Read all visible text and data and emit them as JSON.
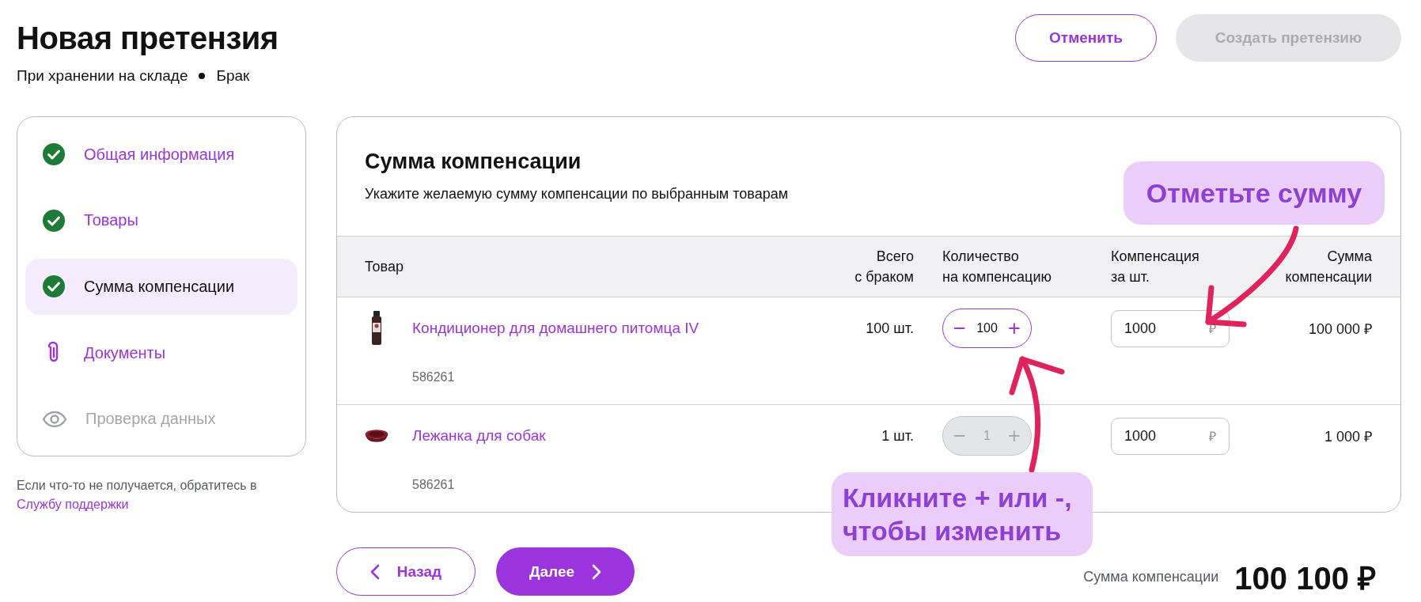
{
  "header": {
    "title": "Новая претензия",
    "subtitle": [
      "При хранении на складе",
      "Брак"
    ],
    "buttons": [
      {
        "kind": "outline",
        "label": "Отменить",
        "disabled": false
      },
      {
        "kind": "primary",
        "label": "Создать претензию",
        "disabled": true
      }
    ]
  },
  "steps": [
    {
      "kind": "check",
      "label": "Общая информация",
      "selected": false,
      "disabled": false
    },
    {
      "kind": "check",
      "label": "Товары",
      "selected": false,
      "disabled": false
    },
    {
      "kind": "check",
      "label": "Сумма компенсации",
      "selected": true,
      "disabled": false
    },
    {
      "kind": "clip",
      "label": "Документы",
      "selected": false,
      "disabled": false
    },
    {
      "kind": "eye",
      "label": "Проверка данных",
      "selected": false,
      "disabled": true
    }
  ],
  "help": {
    "text": "Если что-то не получается, обратитесь в ",
    "link": "Службу поддержки"
  },
  "panel": {
    "title": "Сумма компенсации",
    "description": "Укажите желаемую сумму компенсации по выбранным товарам",
    "columns": [
      {
        "lines": [
          "Товар"
        ]
      },
      {
        "lines": [
          "Всего",
          "с браком"
        ]
      },
      {
        "lines": [
          "Количество",
          "на компенсацию"
        ]
      },
      {
        "lines": [
          "Компенсация",
          "за шт."
        ]
      },
      {
        "lines": [
          "Сумма",
          "компенсации"
        ]
      }
    ],
    "rows": [
      {
        "kind": "bottle",
        "name": "Кондиционер для домашнего питомца IV",
        "sku": "586261",
        "total": "100 шт.",
        "quantity": "100",
        "disabled": false,
        "minus": "−",
        "plus": "+",
        "price": "1000",
        "currency": "₽",
        "sum": "100 000 ₽"
      },
      {
        "kind": "bed",
        "name": "Лежанка для собак",
        "sku": "586261",
        "total": "1 шт.",
        "quantity": "1",
        "disabled": true,
        "minus": "−",
        "plus": "+",
        "price": "1000",
        "currency": "₽",
        "sum": "1 000 ₽"
      }
    ]
  },
  "footer": {
    "back": "Назад",
    "next": "Далее",
    "total_label": "Сумма компенсации",
    "total": "100 100 ₽"
  },
  "callouts": [
    {
      "text": "Отметьте сумму"
    },
    {
      "text": "Кликните + или -,\nчтобы изменить"
    }
  ]
}
